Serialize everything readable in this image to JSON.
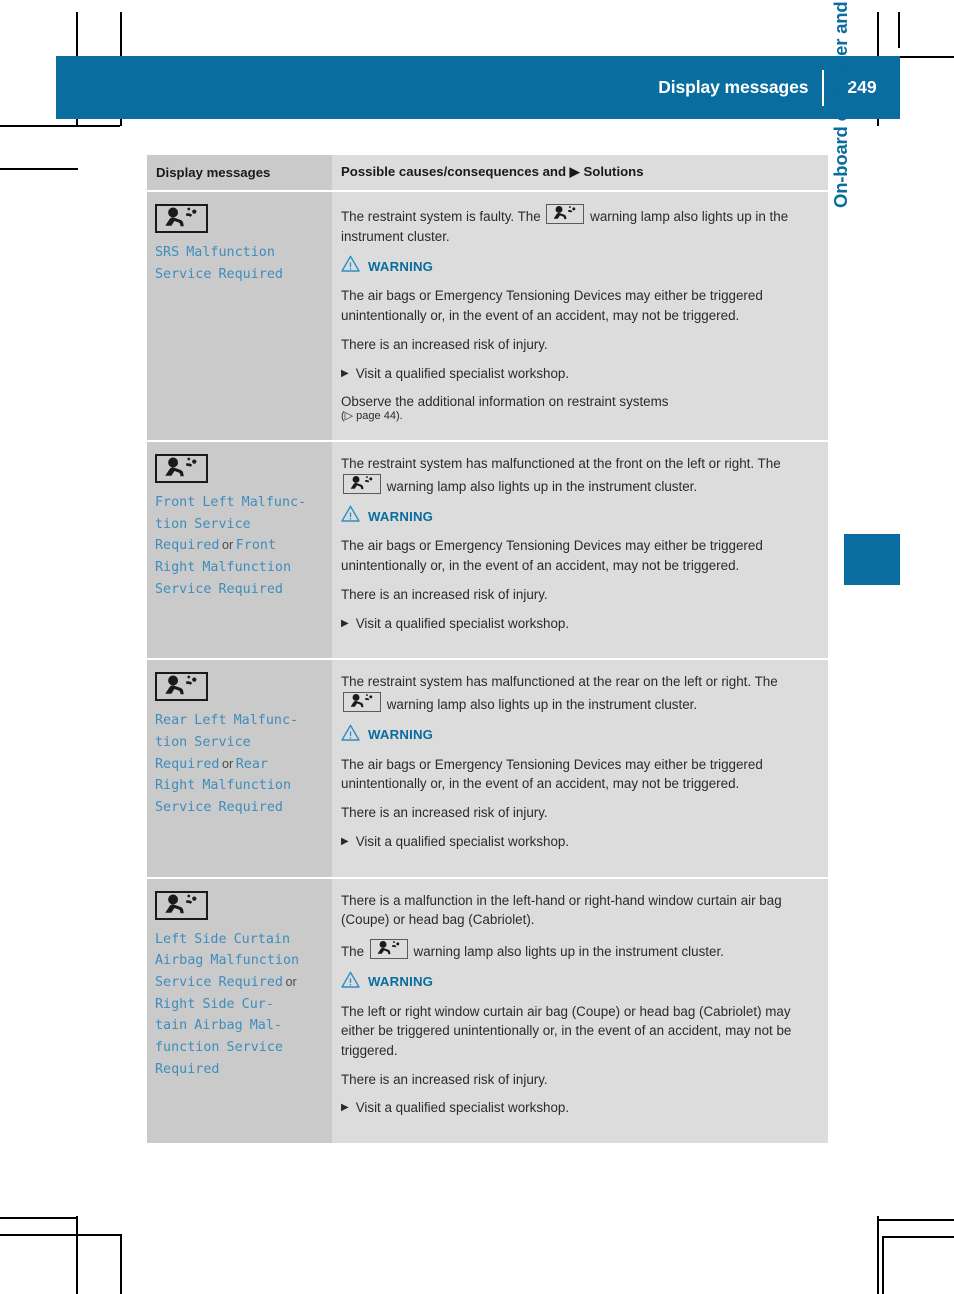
{
  "header": {
    "title": "Display messages",
    "page_number": "249"
  },
  "side_tab": {
    "label": "On-board computer and displays"
  },
  "table": {
    "columns": [
      "Display messages",
      "Possible causes/consequences and ▶ Solutions"
    ],
    "rows": [
      {
        "icon": "airbag-restraint-icon",
        "message": "SRS Malfunction\nService Required",
        "intro": "The restraint system is faulty. The",
        "intro_tail": "warning lamp also lights up in the instrument cluster.",
        "warning_label": "WARNING",
        "warning_paragraphs": [
          "The air bags or Emergency Tensioning Devices may either be triggered unintentionally or, in the event of an accident, may not be triggered.",
          "There is an increased risk of injury."
        ],
        "steps": [
          "Visit a qualified specialist workshop."
        ],
        "note": "Observe the additional information on restraint systems",
        "note_xref": "(▷ page 44)."
      },
      {
        "icon": "airbag-restraint-icon",
        "message_parts": [
          {
            "text": "Front Left Malfunc-\ntion Service\nRequired",
            "style": "message"
          },
          {
            "text": " or ",
            "style": "plain"
          },
          {
            "text": "Front\nRight Malfunction\nService Required",
            "style": "message"
          }
        ],
        "intro": "The restraint system has malfunctioned at the front on the left or right. The",
        "intro_tail": "warning lamp also lights up in the instrument cluster.",
        "warning_label": "WARNING",
        "warning_paragraphs": [
          "The air bags or Emergency Tensioning Devices may either be triggered unintentionally or, in the event of an accident, may not be triggered.",
          "There is an increased risk of injury."
        ],
        "steps": [
          "Visit a qualified specialist workshop."
        ]
      },
      {
        "icon": "airbag-restraint-icon",
        "message_parts": [
          {
            "text": "Rear Left Malfunc-\ntion Service\nRequired",
            "style": "message"
          },
          {
            "text": " or ",
            "style": "plain"
          },
          {
            "text": "Rear\nRight Malfunction\nService Required",
            "style": "message"
          }
        ],
        "intro": "The restraint system has malfunctioned at the rear on the left or right. The",
        "intro_tail": "warning lamp also lights up in the instrument cluster.",
        "warning_label": "WARNING",
        "warning_paragraphs": [
          "The air bags or Emergency Tensioning Devices may either be triggered unintentionally or, in the event of an accident, may not be triggered.",
          "There is an increased risk of injury."
        ],
        "steps": [
          "Visit a qualified specialist workshop."
        ]
      },
      {
        "icon": "airbag-restraint-icon",
        "message_parts": [
          {
            "text": "Left Side Curtain\nAirbag Malfunction\nService Required",
            "style": "message"
          },
          {
            "text": " or ",
            "style": "plain"
          },
          {
            "text": "\nRight Side Cur-\ntain Airbag Mal-\nfunction Service\nRequired",
            "style": "message"
          }
        ],
        "intro_full": "There is a malfunction in the left-hand or right-hand window curtain air bag (Coupe) or head bag (Cabriolet).",
        "intro": "The",
        "intro_tail": "warning lamp also lights up in the instrument cluster.",
        "warning_label": "WARNING",
        "warning_paragraphs": [
          "The left or right window curtain air bag (Coupe) or head bag (Cabriolet) may either be triggered unintentionally or, in the event of an accident, may not be triggered.",
          "There is an increased risk of injury."
        ],
        "steps": [
          "Visit a qualified specialist workshop."
        ]
      }
    ]
  },
  "colors": {
    "brand_blue": "#0a6da0",
    "message_blue": "#3e8dbd",
    "left_cell_gray": "#cacaca",
    "right_cell_gray": "#dcdcdc"
  }
}
